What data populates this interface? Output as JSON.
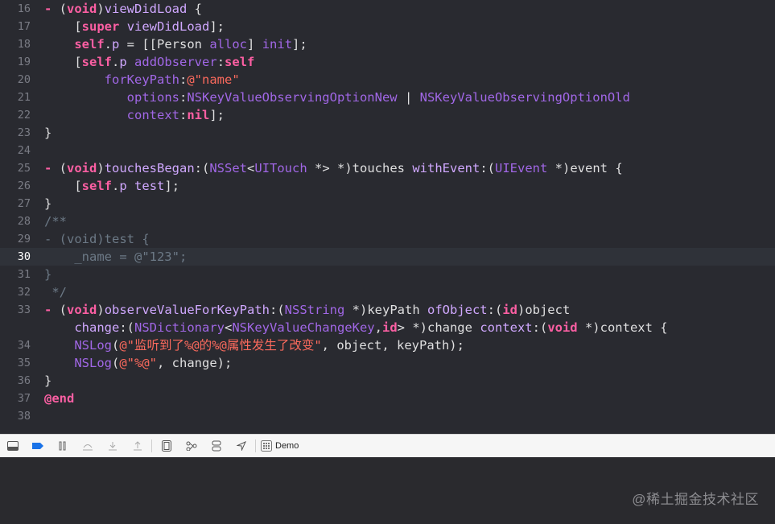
{
  "editor": {
    "current_line": 30,
    "lines": [
      {
        "n": "16",
        "t": [
          [
            "kw",
            "- "
          ],
          [
            "tx",
            "("
          ],
          [
            "kw",
            "void"
          ],
          [
            "tx",
            ")"
          ],
          [
            "cl",
            "viewDidLoad"
          ],
          [
            "tx",
            " {"
          ]
        ]
      },
      {
        "n": "17",
        "t": [
          [
            "tx",
            "    ["
          ],
          [
            "kw",
            "super"
          ],
          [
            "tx",
            " "
          ],
          [
            "cl",
            "viewDidLoad"
          ],
          [
            "tx",
            "];"
          ]
        ]
      },
      {
        "n": "18",
        "t": [
          [
            "tx",
            "    "
          ],
          [
            "kw",
            "self"
          ],
          [
            "tx",
            "."
          ],
          [
            "cl",
            "p"
          ],
          [
            "tx",
            " = [["
          ],
          [
            "tx",
            "Person"
          ],
          [
            "tx",
            " "
          ],
          [
            "pl",
            "alloc"
          ],
          [
            "tx",
            "] "
          ],
          [
            "pl",
            "init"
          ],
          [
            "tx",
            "];"
          ]
        ]
      },
      {
        "n": "19",
        "t": [
          [
            "tx",
            "    ["
          ],
          [
            "kw",
            "self"
          ],
          [
            "tx",
            "."
          ],
          [
            "cl",
            "p"
          ],
          [
            "tx",
            " "
          ],
          [
            "pl",
            "addObserver"
          ],
          [
            "tx",
            ":"
          ],
          [
            "kw",
            "self"
          ]
        ]
      },
      {
        "n": "20",
        "t": [
          [
            "tx",
            "        "
          ],
          [
            "pl",
            "forKeyPath"
          ],
          [
            "tx",
            ":"
          ],
          [
            "str",
            "@\"name\""
          ]
        ]
      },
      {
        "n": "21",
        "t": [
          [
            "tx",
            "           "
          ],
          [
            "pl",
            "options"
          ],
          [
            "tx",
            ":"
          ],
          [
            "pl",
            "NSKeyValueObservingOptionNew"
          ],
          [
            "tx",
            " | "
          ],
          [
            "pl",
            "NSKeyValueObservingOptionOld"
          ]
        ]
      },
      {
        "n": "22",
        "t": [
          [
            "tx",
            "           "
          ],
          [
            "pl",
            "context"
          ],
          [
            "tx",
            ":"
          ],
          [
            "kw",
            "nil"
          ],
          [
            "tx",
            "];"
          ]
        ]
      },
      {
        "n": "23",
        "t": [
          [
            "tx",
            "}"
          ]
        ]
      },
      {
        "n": "24",
        "t": []
      },
      {
        "n": "25",
        "t": [
          [
            "kw",
            "- "
          ],
          [
            "tx",
            "("
          ],
          [
            "kw",
            "void"
          ],
          [
            "tx",
            ")"
          ],
          [
            "cl",
            "touchesBegan"
          ],
          [
            "tx",
            ":("
          ],
          [
            "pl",
            "NSSet"
          ],
          [
            "tx",
            "<"
          ],
          [
            "pl",
            "UITouch"
          ],
          [
            "tx",
            " *> *)touches "
          ],
          [
            "cl",
            "withEvent"
          ],
          [
            "tx",
            ":("
          ],
          [
            "pl",
            "UIEvent"
          ],
          [
            "tx",
            " *)event {"
          ]
        ]
      },
      {
        "n": "26",
        "t": [
          [
            "tx",
            "    ["
          ],
          [
            "kw",
            "self"
          ],
          [
            "tx",
            "."
          ],
          [
            "cl",
            "p"
          ],
          [
            "tx",
            " "
          ],
          [
            "cl",
            "test"
          ],
          [
            "tx",
            "];"
          ]
        ]
      },
      {
        "n": "27",
        "t": [
          [
            "tx",
            "}"
          ]
        ]
      },
      {
        "n": "28",
        "t": [
          [
            "cm",
            "/**"
          ]
        ]
      },
      {
        "n": "29",
        "t": [
          [
            "cm",
            "- (void)test {"
          ]
        ]
      },
      {
        "n": "30",
        "t": [
          [
            "cm",
            "    _name = @\"123\";"
          ]
        ]
      },
      {
        "n": "31",
        "t": [
          [
            "cm",
            "}"
          ]
        ]
      },
      {
        "n": "32",
        "t": [
          [
            "cm",
            " */"
          ]
        ]
      },
      {
        "n": "33",
        "t": [
          [
            "kw",
            "- "
          ],
          [
            "tx",
            "("
          ],
          [
            "kw",
            "void"
          ],
          [
            "tx",
            ")"
          ],
          [
            "cl",
            "observeValueForKeyPath"
          ],
          [
            "tx",
            ":("
          ],
          [
            "pl",
            "NSString"
          ],
          [
            "tx",
            " *)keyPath "
          ],
          [
            "cl",
            "ofObject"
          ],
          [
            "tx",
            ":("
          ],
          [
            "kw",
            "id"
          ],
          [
            "tx",
            ")object"
          ]
        ]
      },
      {
        "n": "",
        "t": [
          [
            "tx",
            "    "
          ],
          [
            "cl",
            "change"
          ],
          [
            "tx",
            ":("
          ],
          [
            "pl",
            "NSDictionary"
          ],
          [
            "tx",
            "<"
          ],
          [
            "pl",
            "NSKeyValueChangeKey"
          ],
          [
            "tx",
            ","
          ],
          [
            "kw",
            "id"
          ],
          [
            "tx",
            "> *)change "
          ],
          [
            "cl",
            "context"
          ],
          [
            "tx",
            ":("
          ],
          [
            "kw",
            "void"
          ],
          [
            "tx",
            " *)context {"
          ]
        ]
      },
      {
        "n": "34",
        "t": [
          [
            "tx",
            "    "
          ],
          [
            "pl",
            "NSLog"
          ],
          [
            "tx",
            "("
          ],
          [
            "str",
            "@\"监听到了%@的%@属性发生了改变\""
          ],
          [
            "tx",
            ", object, keyPath);"
          ]
        ]
      },
      {
        "n": "35",
        "t": [
          [
            "tx",
            "    "
          ],
          [
            "pl",
            "NSLog"
          ],
          [
            "tx",
            "("
          ],
          [
            "str",
            "@\"%@\""
          ],
          [
            "tx",
            ", change);"
          ]
        ]
      },
      {
        "n": "36",
        "t": [
          [
            "tx",
            "}"
          ]
        ]
      },
      {
        "n": "37",
        "t": [
          [
            "kw",
            "@end"
          ]
        ]
      },
      {
        "n": "38",
        "t": []
      }
    ]
  },
  "debug_bar": {
    "buttons": [
      {
        "name": "hide-debug-area-icon"
      },
      {
        "name": "breakpoints-toggle-icon"
      },
      {
        "name": "pause-icon"
      },
      {
        "name": "step-over-icon"
      },
      {
        "name": "step-into-icon"
      },
      {
        "name": "step-out-icon"
      },
      {
        "name": "view-hierarchy-icon"
      },
      {
        "name": "memory-graph-icon"
      },
      {
        "name": "environment-overrides-icon"
      },
      {
        "name": "simulate-location-icon"
      }
    ],
    "target_label": "Demo"
  },
  "watermark": "@稀土掘金技术社区",
  "colors": {
    "editor_bg": "#292a30",
    "keyword": "#fc5fa3",
    "project_symbol": "#a167e6",
    "class_symbol": "#d0a8ff",
    "string": "#fc6a5d",
    "comment": "#6c7986",
    "current_line": "#2f3239",
    "accent_blue": "#1a73e8"
  }
}
